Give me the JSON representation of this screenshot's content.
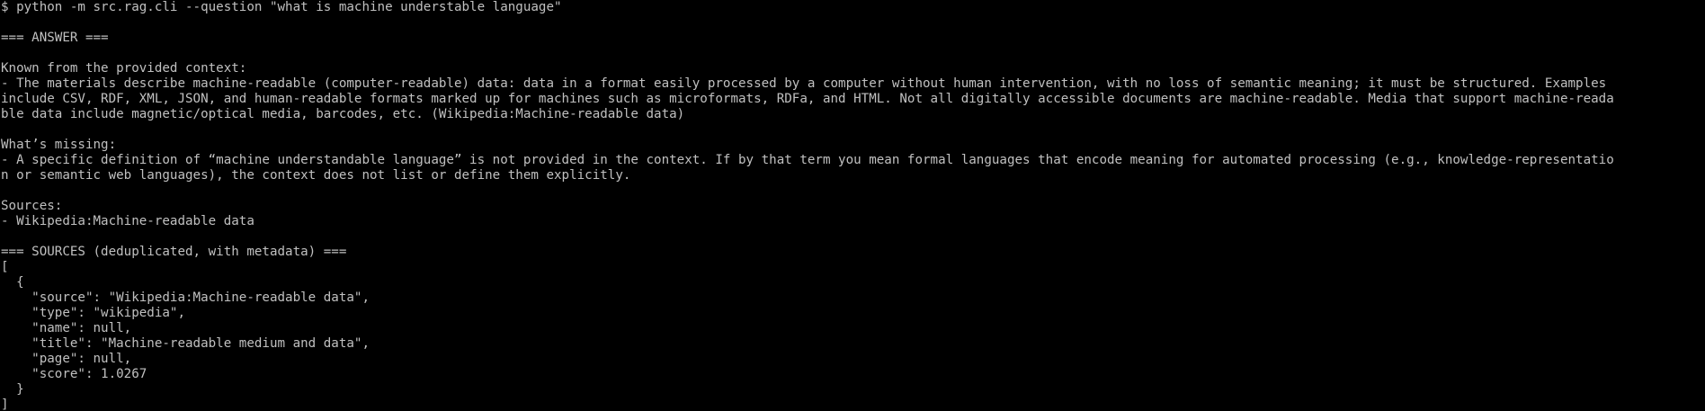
{
  "terminal": {
    "lines": [
      "$ python -m src.rag.cli --question \"what is machine understable language\"",
      "",
      "=== ANSWER ===",
      "",
      "Known from the provided context:",
      "- The materials describe machine-readable (computer-readable) data: data in a format easily processed by a computer without human intervention, with no loss of semantic meaning; it must be structured. Examples",
      "include CSV, RDF, XML, JSON, and human-readable formats marked up for machines such as microformats, RDFa, and HTML. Not all digitally accessible documents are machine-readable. Media that support machine-reada",
      "ble data include magnetic/optical media, barcodes, etc. (Wikipedia:Machine-readable data)",
      "",
      "What’s missing:",
      "- A specific definition of “machine understandable language” is not provided in the context. If by that term you mean formal languages that encode meaning for automated processing (e.g., knowledge-representatio",
      "n or semantic web languages), the context does not list or define them explicitly.",
      "",
      "Sources:",
      "- Wikipedia:Machine-readable data",
      "",
      "=== SOURCES (deduplicated, with metadata) ===",
      "[",
      "  {",
      "    \"source\": \"Wikipedia:Machine-readable data\",",
      "    \"type\": \"wikipedia\",",
      "    \"name\": null,",
      "    \"title\": \"Machine-readable medium and data\",",
      "    \"page\": null,",
      "    \"score\": 1.0267",
      "  }",
      "]"
    ]
  }
}
